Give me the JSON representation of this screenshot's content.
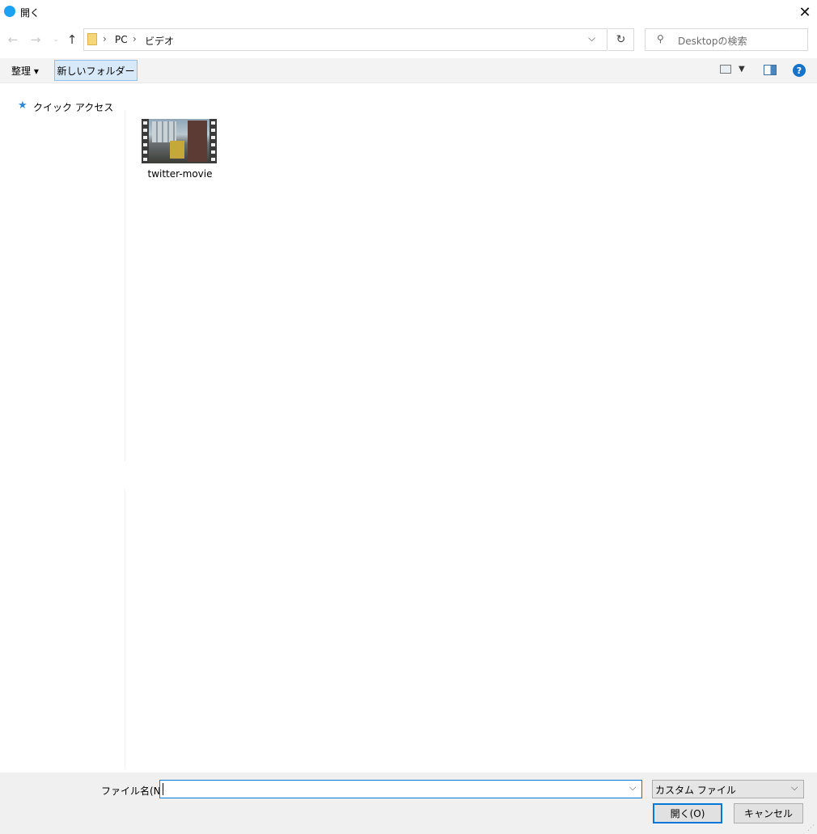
{
  "window": {
    "title": "開く",
    "close_icon": "close-icon"
  },
  "nav": {
    "back_icon": "arrow-left-icon",
    "forward_icon": "arrow-right-icon",
    "recent_icon": "chevron-down-icon",
    "up_icon": "arrow-up-icon",
    "breadcrumb": [
      {
        "label": "PC"
      },
      {
        "label": "ビデオ"
      }
    ],
    "separator": "›",
    "refresh_icon": "refresh-icon",
    "search_placeholder": "Desktopの検索"
  },
  "toolbar": {
    "organize_label": "整理 ▾",
    "new_folder_label": "新しいフォルダー",
    "help_label": "?"
  },
  "sidebar": {
    "items": [
      {
        "label": "クイック アクセス",
        "icon": "star-icon"
      }
    ]
  },
  "files": [
    {
      "name": "twitter-movie",
      "type": "video"
    }
  ],
  "bottom": {
    "filename_label": "ファイル名(N):",
    "filename_value": "",
    "filter_value": "カスタム ファイル",
    "open_label": "開く(O)",
    "cancel_label": "キャンセル"
  },
  "colors": {
    "accent": "#0078d7",
    "new_folder_bg": "#d8eaf9",
    "app_icon": "#1da1f2"
  }
}
